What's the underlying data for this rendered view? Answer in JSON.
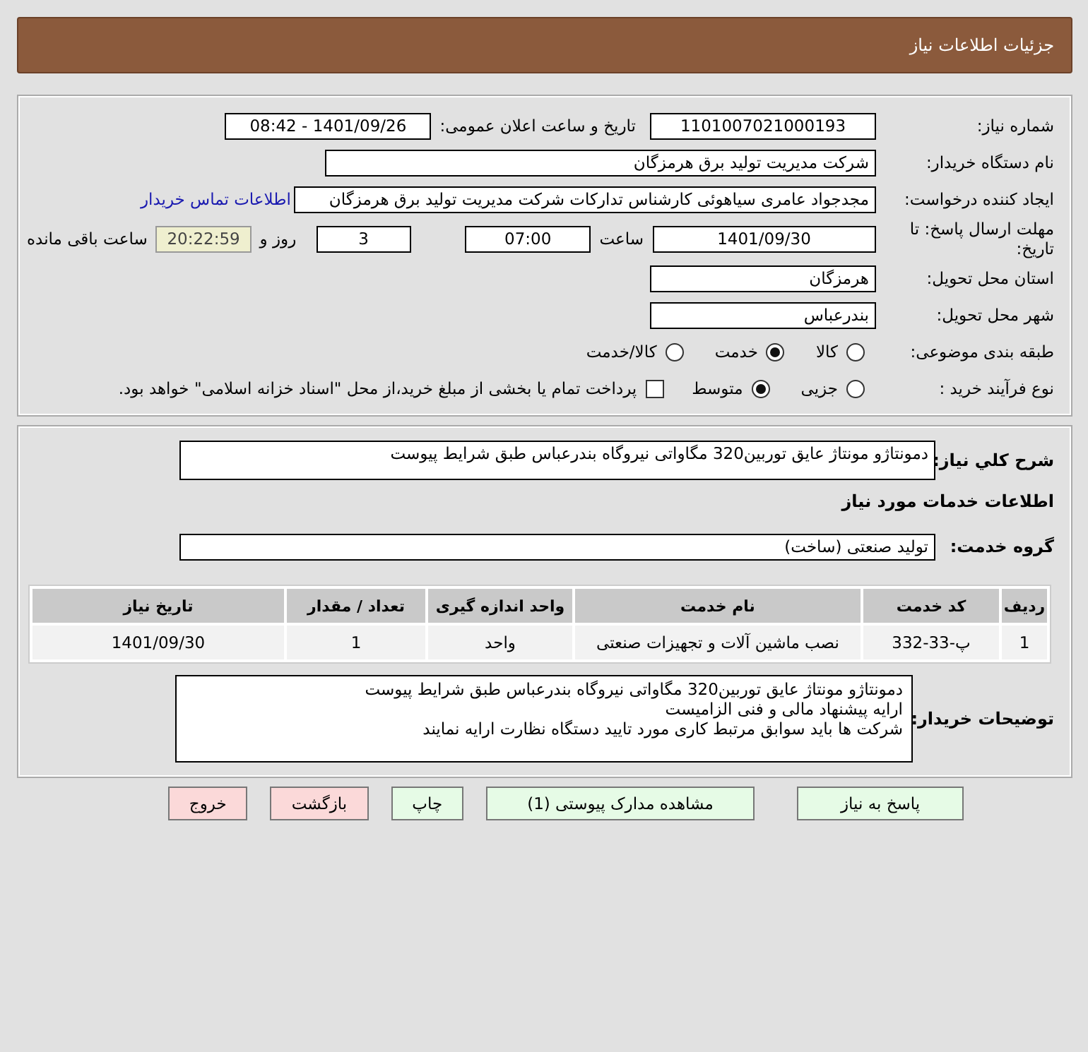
{
  "header": {
    "title": "جزئیات اطلاعات نیاز"
  },
  "details": {
    "need_number": {
      "label": "شماره نیاز:",
      "value": "1101007021000193"
    },
    "announce_datetime": {
      "label": "تاریخ و ساعت اعلان عمومی:",
      "value": "1401/09/26 - 08:42"
    },
    "buyer_org": {
      "label": "نام دستگاه خریدار:",
      "value": "شرکت مدیریت تولید برق هرمزگان"
    },
    "requester": {
      "label": "ایجاد کننده درخواست:",
      "value": "مجدجواد عامری سیاهوئی کارشناس تدارکات شرکت مدیریت تولید برق هرمزگان",
      "link": "اطلاعات تماس خریدار"
    },
    "deadline": {
      "label": "مهلت ارسال پاسخ: تا تاریخ:",
      "date": "1401/09/30",
      "time_label": "ساعت",
      "time": "07:00",
      "days": "3",
      "days_label": "روز و",
      "remaining": "20:22:59",
      "remaining_label": "ساعت باقی مانده"
    },
    "province": {
      "label": "استان محل تحویل:",
      "value": "هرمزگان"
    },
    "city": {
      "label": "شهر محل تحویل:",
      "value": "بندرعباس"
    },
    "category": {
      "label": "طبقه بندی موضوعی:",
      "options": [
        {
          "label": "کالا",
          "selected": false
        },
        {
          "label": "خدمت",
          "selected": true
        },
        {
          "label": "کالا/خدمت",
          "selected": false
        }
      ]
    },
    "process": {
      "label": "نوع فرآیند خرید :",
      "options": [
        {
          "label": "جزیی",
          "selected": false
        },
        {
          "label": "متوسط",
          "selected": true
        }
      ],
      "payment": {
        "checked": false,
        "label": "پرداخت تمام یا بخشی از مبلغ خرید،از محل \"اسناد خزانه اسلامی\" خواهد بود."
      }
    }
  },
  "summary": {
    "label": "شرح کلي نياز:",
    "value": "دمونتاژو مونتاژ عایق توربین320 مگاواتی نیروگاه بندرعباس طبق شرایط پیوست"
  },
  "services_heading": "اطلاعات خدمات مورد نیاز",
  "service_group": {
    "label": "گروه خدمت:",
    "value": "تولید صنعتی (ساخت)"
  },
  "table": {
    "columns": [
      "ردیف",
      "کد خدمت",
      "نام خدمت",
      "واحد اندازه گیری",
      "تعداد / مقدار",
      "تاریخ نیاز"
    ],
    "rows": [
      [
        "1",
        "پ-33-332",
        "نصب ماشین آلات و تجهیزات صنعتی",
        "واحد",
        "1",
        "1401/09/30"
      ]
    ]
  },
  "buyer_notes": {
    "label": "توضیحات خریدار:",
    "lines": [
      "دمونتاژو مونتاژ عایق توربین320 مگاواتی نیروگاه بندرعباس طبق شرایط پیوست",
      "ارایه پیشنهاد مالی و فنی الزامیست",
      "شرکت ها باید سوابق مرتبط کاری مورد تایید دستگاه نظارت ارایه نمایند"
    ]
  },
  "buttons": [
    {
      "label": "پاسخ به نیاز",
      "kind": "action"
    },
    {
      "label": "مشاهده مدارک پیوستی (1)",
      "kind": "action"
    },
    {
      "label": "چاپ",
      "kind": "action"
    },
    {
      "label": "بازگشت",
      "kind": "exit"
    },
    {
      "label": "خروج",
      "kind": "exit"
    }
  ]
}
